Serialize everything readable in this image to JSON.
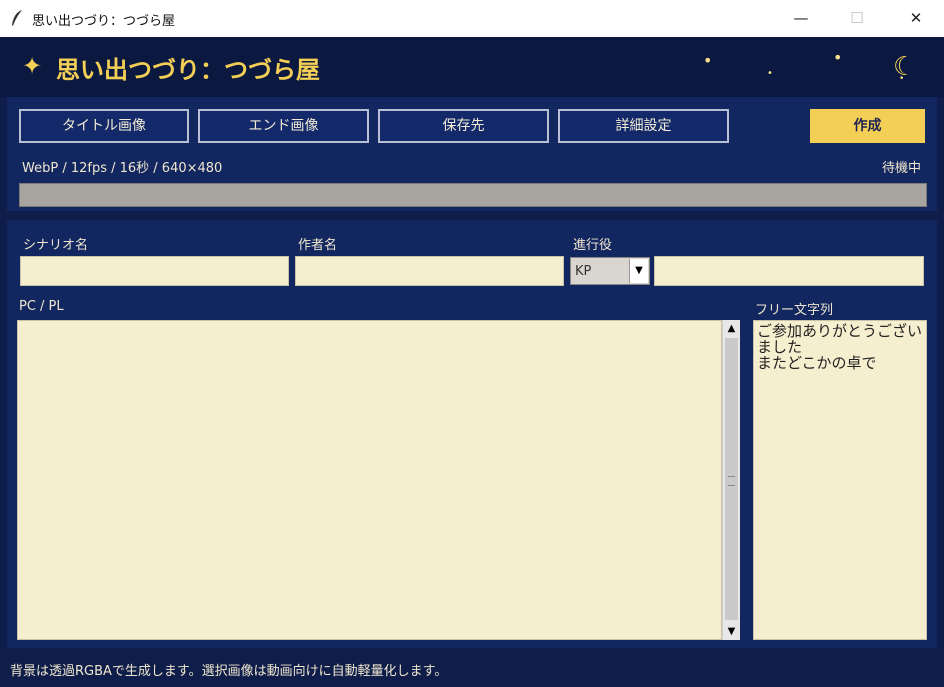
{
  "window": {
    "title": "思い出つづり：つづら屋",
    "minimize": "—",
    "maximize": "☐",
    "close": "✕"
  },
  "header": {
    "sparkle": "✦",
    "title": "思い出つづり：つづら屋",
    "moon": "☾",
    "star": "•"
  },
  "toolbar": {
    "title_image": "タイトル画像",
    "end_image": "エンド画像",
    "save_dest": "保存先",
    "advanced": "詳細設定",
    "create": "作成"
  },
  "output": {
    "info": "WebP / 12fps / 16秒 / 640×480",
    "status": "待機中",
    "progress": 0
  },
  "form": {
    "scenario_label": "シナリオ名",
    "scenario_value": "",
    "author_label": "作者名",
    "author_value": "",
    "gm_label": "進行役",
    "gm_select": "KP",
    "gm_value": "",
    "pcpl_label": "PC / PL",
    "pcpl_value": "",
    "free_label": "フリー文字列",
    "free_value": "ご参加ありがとうございました\nまたどこかの卓で"
  },
  "footer": {
    "note": "背景は透過RGBAで生成します。選択画像は動画向けに自動軽量化します。"
  },
  "colors": {
    "background": "#0f1d4a",
    "panel": "#122660",
    "accent": "#f3cf55",
    "field": "#f6efcf"
  }
}
